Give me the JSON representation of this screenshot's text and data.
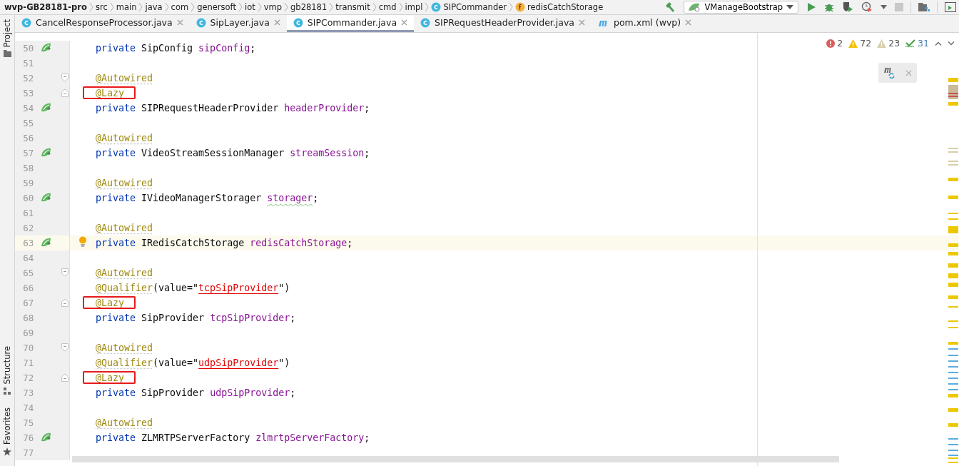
{
  "breadcrumbs": [
    {
      "label": "wvp-GB28181-pro",
      "kind": "project"
    },
    {
      "label": "src",
      "kind": "folder"
    },
    {
      "label": "main",
      "kind": "folder"
    },
    {
      "label": "java",
      "kind": "folder"
    },
    {
      "label": "com",
      "kind": "folder"
    },
    {
      "label": "genersoft",
      "kind": "folder"
    },
    {
      "label": "iot",
      "kind": "folder"
    },
    {
      "label": "vmp",
      "kind": "folder"
    },
    {
      "label": "gb28181",
      "kind": "folder"
    },
    {
      "label": "transmit",
      "kind": "folder"
    },
    {
      "label": "cmd",
      "kind": "folder"
    },
    {
      "label": "impl",
      "kind": "folder"
    },
    {
      "label": "SIPCommander",
      "kind": "class"
    },
    {
      "label": "redisCatchStorage",
      "kind": "field"
    }
  ],
  "run_config": {
    "label": "VManageBootstrap"
  },
  "tabs": [
    {
      "label": "CancelResponseProcessor.java",
      "kind": "class",
      "selected": false
    },
    {
      "label": "SipLayer.java",
      "kind": "class",
      "selected": false
    },
    {
      "label": "SIPCommander.java",
      "kind": "class",
      "selected": true
    },
    {
      "label": "SIPRequestHeaderProvider.java",
      "kind": "class",
      "selected": false
    },
    {
      "label": "pom.xml (wvp)",
      "kind": "maven",
      "selected": false
    }
  ],
  "tool_windows": [
    {
      "label": "Project",
      "kind": "folder"
    },
    {
      "label": "Structure",
      "kind": "structure"
    },
    {
      "label": "Favorites",
      "kind": "star"
    }
  ],
  "inspections": {
    "errors": "2",
    "warnings": "72",
    "weak_warnings": "23",
    "typos": "31"
  },
  "lines": [
    {
      "n": "50",
      "bean": true,
      "tokens": [
        {
          "kind": "kw",
          "text": "private"
        },
        {
          "kind": "plain",
          "text": " SipConfig "
        },
        {
          "kind": "field",
          "text": "sipConfig"
        },
        {
          "kind": "plain",
          "text": ";"
        }
      ]
    },
    {
      "n": "51"
    },
    {
      "n": "52",
      "fold_start": true,
      "tokens": [
        {
          "kind": "ann",
          "text": "@Autowired"
        }
      ]
    },
    {
      "n": "53",
      "fold_end": true,
      "marked": true,
      "tokens": [
        {
          "kind": "ann",
          "text": "@Lazy"
        }
      ]
    },
    {
      "n": "54",
      "bean": true,
      "tokens": [
        {
          "kind": "kw",
          "text": "private"
        },
        {
          "kind": "plain",
          "text": " SIPRequestHeaderProvider "
        },
        {
          "kind": "field",
          "text": "headerProvider"
        },
        {
          "kind": "plain",
          "text": ";"
        }
      ]
    },
    {
      "n": "55"
    },
    {
      "n": "56",
      "tokens": [
        {
          "kind": "ann",
          "text": "@Autowired"
        }
      ]
    },
    {
      "n": "57",
      "bean": true,
      "tokens": [
        {
          "kind": "kw",
          "text": "private"
        },
        {
          "kind": "plain",
          "text": " VideoStreamSessionManager "
        },
        {
          "kind": "field",
          "text": "streamSession"
        },
        {
          "kind": "plain",
          "text": ";"
        }
      ]
    },
    {
      "n": "58"
    },
    {
      "n": "59",
      "tokens": [
        {
          "kind": "ann",
          "text": "@Autowired"
        }
      ]
    },
    {
      "n": "60",
      "bean": true,
      "tokens": [
        {
          "kind": "kw",
          "text": "private"
        },
        {
          "kind": "plain",
          "text": " IVideoManagerStorager "
        },
        {
          "kind": "typo",
          "text": "storager"
        },
        {
          "kind": "plain",
          "text": ";"
        }
      ]
    },
    {
      "n": "61"
    },
    {
      "n": "62",
      "tokens": [
        {
          "kind": "ann",
          "text": "@Autowired"
        }
      ]
    },
    {
      "n": "63",
      "bean": true,
      "current": true,
      "bulb": true,
      "tokens": [
        {
          "kind": "kw",
          "text": "private"
        },
        {
          "kind": "plain",
          "text": " IRedisCatchStorage "
        },
        {
          "kind": "field",
          "text": "redisCatchStorage"
        },
        {
          "kind": "plain",
          "text": ";"
        }
      ]
    },
    {
      "n": "64"
    },
    {
      "n": "65",
      "fold_start": true,
      "tokens": [
        {
          "kind": "ann",
          "text": "@Autowired"
        }
      ]
    },
    {
      "n": "66",
      "tokens": [
        {
          "kind": "ann",
          "text": "@Qualifier"
        },
        {
          "kind": "plain",
          "text": "(value=\""
        },
        {
          "kind": "err",
          "text": "tcpSipProvider"
        },
        {
          "kind": "plain",
          "text": "\")"
        }
      ]
    },
    {
      "n": "67",
      "fold_end": true,
      "marked": true,
      "tokens": [
        {
          "kind": "ann",
          "text": "@Lazy"
        }
      ]
    },
    {
      "n": "68",
      "tokens": [
        {
          "kind": "kw",
          "text": "private"
        },
        {
          "kind": "plain",
          "text": " SipProvider "
        },
        {
          "kind": "field",
          "text": "tcpSipProvider"
        },
        {
          "kind": "plain",
          "text": ";"
        }
      ]
    },
    {
      "n": "69"
    },
    {
      "n": "70",
      "fold_start": true,
      "tokens": [
        {
          "kind": "ann",
          "text": "@Autowired"
        }
      ]
    },
    {
      "n": "71",
      "tokens": [
        {
          "kind": "ann",
          "text": "@Qualifier"
        },
        {
          "kind": "plain",
          "text": "(value=\""
        },
        {
          "kind": "err",
          "text": "udpSipProvider"
        },
        {
          "kind": "plain",
          "text": "\")"
        }
      ]
    },
    {
      "n": "72",
      "fold_end": true,
      "marked": true,
      "tokens": [
        {
          "kind": "ann",
          "text": "@Lazy"
        }
      ]
    },
    {
      "n": "73",
      "tokens": [
        {
          "kind": "kw",
          "text": "private"
        },
        {
          "kind": "plain",
          "text": " SipProvider "
        },
        {
          "kind": "field",
          "text": "udpSipProvider"
        },
        {
          "kind": "plain",
          "text": ";"
        }
      ]
    },
    {
      "n": "74"
    },
    {
      "n": "75",
      "tokens": [
        {
          "kind": "ann",
          "text": "@Autowired"
        }
      ]
    },
    {
      "n": "76",
      "bean": true,
      "tokens": [
        {
          "kind": "kw",
          "text": "private"
        },
        {
          "kind": "plain",
          "text": " ZLMRTPServerFactory "
        },
        {
          "kind": "field",
          "text": "zlmrtpServerFactory"
        },
        {
          "kind": "plain",
          "text": ";"
        }
      ]
    },
    {
      "n": "77"
    }
  ]
}
